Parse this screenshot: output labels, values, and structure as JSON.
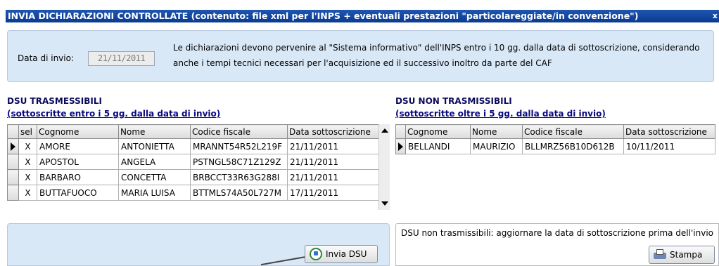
{
  "window": {
    "title": "INVIA DICHIARAZIONI CONTROLLATE (contenuto: file xml per l'INPS + eventuali prestazioni \"particolareggiate/in convenzione\")",
    "close_glyph": "x"
  },
  "info": {
    "date_label": "Data di invio:",
    "date_value": "21/11/2011",
    "message": "Le dichiarazioni devono pervenire al \"Sistema informativo\" dell'INPS entro i 10 gg. dalla data di sottoscrizione, considerando anche i tempi tecnici necessari per l'acquisizione ed il successivo inoltro da parte del CAF"
  },
  "trasmissibili": {
    "title": "DSU TRASMESSIBILI",
    "subtitle": "(sottoscritte entro i 5 gg. dalla data di invio)",
    "columns": [
      "sel",
      "Cognome",
      "Nome",
      "Codice fiscale",
      "Data sottoscrizione"
    ],
    "rows": [
      {
        "sel": "X",
        "cognome": "AMORE",
        "nome": "ANTONIETTA",
        "cf": "MRANNT54R52L219F",
        "data": "21/11/2011"
      },
      {
        "sel": "X",
        "cognome": "APOSTOL",
        "nome": "ANGELA",
        "cf": "PSTNGL58C71Z129Z",
        "data": "21/11/2011"
      },
      {
        "sel": "X",
        "cognome": "BARBARO",
        "nome": "CONCETTA",
        "cf": "BRBCCT33R63G288I",
        "data": "21/11/2011"
      },
      {
        "sel": "X",
        "cognome": "BUTTAFUOCO",
        "nome": "MARIA LUISA",
        "cf": "BTTMLS74A50L727M",
        "data": "17/11/2011"
      }
    ]
  },
  "non_trasmissibili": {
    "title": "DSU NON TRASMISSIBILI",
    "subtitle": "(sottoscritte oltre i 5 gg. dalla data di invio)",
    "columns": [
      "Cognome",
      "Nome",
      "Codice fiscale",
      "Data sottoscrizione"
    ],
    "rows": [
      {
        "cognome": "BELLANDI",
        "nome": "MAURIZIO",
        "cf": "BLLMRZ56B10D612B",
        "data": "10/11/2011"
      }
    ],
    "note": "DSU non trasmissibili: aggiornare la data di sottoscrizione prima dell'invio"
  },
  "buttons": {
    "invia_label": "Invia DSU",
    "stampa_label": "Stampa"
  },
  "icons": {
    "invia": "refresh-icon",
    "stampa": "printer-icon",
    "row_pointer": "row-pointer-icon"
  }
}
